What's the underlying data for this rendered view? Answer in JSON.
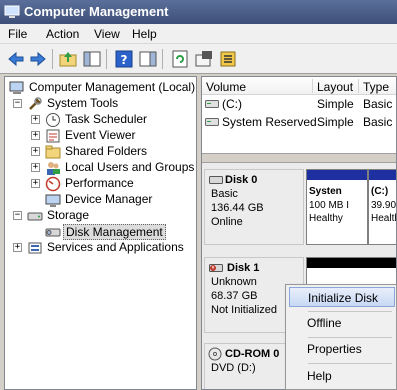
{
  "window": {
    "title": "Computer Management"
  },
  "menu": [
    "File",
    "Action",
    "View",
    "Help"
  ],
  "toolbar": {
    "buttons": [
      "back-icon",
      "forward-icon",
      "up-folder-icon",
      "show-hide-tree-icon",
      "help-icon",
      "properties-pane-icon",
      "refresh-icon",
      "properties-icon",
      "export-list-icon"
    ]
  },
  "tree": {
    "root": "Computer Management (Local)",
    "system_tools": "System Tools",
    "task_scheduler": "Task Scheduler",
    "event_viewer": "Event Viewer",
    "shared_folders": "Shared Folders",
    "local_users": "Local Users and Groups",
    "performance": "Performance",
    "device_manager": "Device Manager",
    "storage": "Storage",
    "disk_management": "Disk Management",
    "services": "Services and Applications",
    "expander_plus": "+",
    "expander_minus": "−"
  },
  "volume_list": {
    "headers": [
      "Volume",
      "Layout",
      "Type"
    ],
    "rows": [
      {
        "volume": "(C:)",
        "layout": "Simple",
        "type": "Basic"
      },
      {
        "volume": "System Reserved",
        "layout": "Simple",
        "type": "Basic"
      }
    ]
  },
  "disks": [
    {
      "name": "Disk 0",
      "type": "Basic",
      "size": "136.44 GB",
      "status": "Online",
      "partitions": [
        {
          "name": "Systen",
          "line1": "100 MB I",
          "line2": "Healthy"
        },
        {
          "name": "(C:)",
          "line1": "39.90",
          "line2": "Healthy"
        }
      ]
    },
    {
      "name": "Disk 1",
      "type": "Unknown",
      "size": "68.37 GB",
      "status": "Not Initialized"
    },
    {
      "name": "CD-ROM 0",
      "type": "DVD (D:)"
    }
  ],
  "context_menu": {
    "items": [
      "Initialize Disk",
      "Offline",
      "Properties",
      "Help"
    ]
  },
  "colors": {
    "titlebar": "#3d4f78",
    "partition_bar": "#1e30a0",
    "unallocated_bar": "#000000",
    "menu_highlight": "#c8d8f4"
  }
}
